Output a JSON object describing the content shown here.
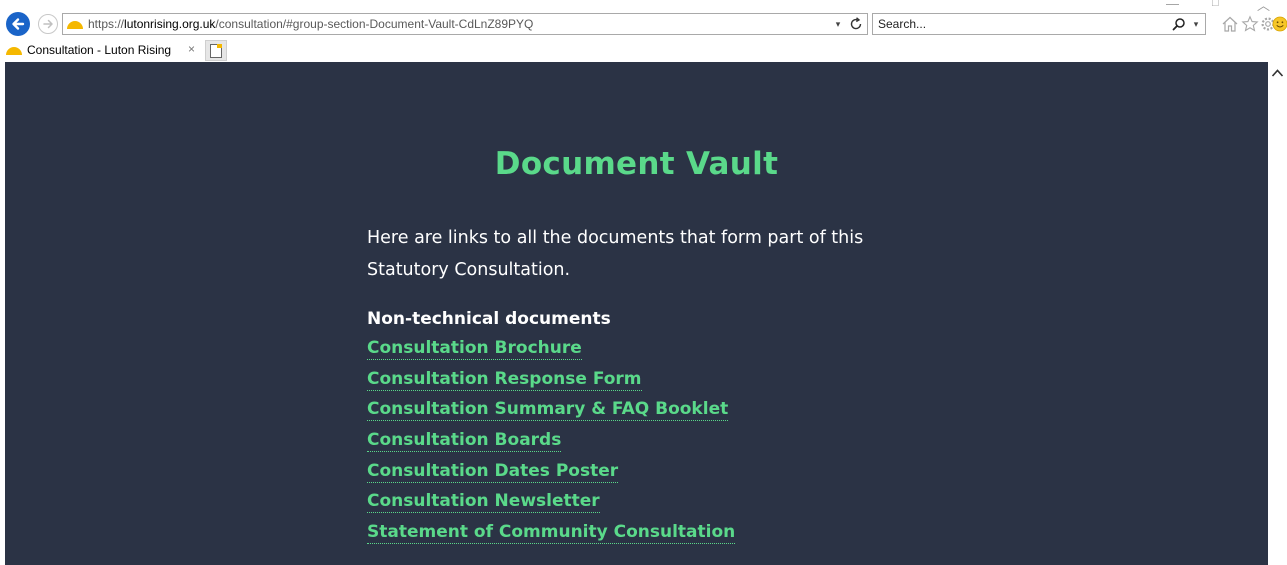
{
  "browser": {
    "url_prefix": "https://",
    "url_domain": "lutonrising.org.uk",
    "url_path": "/consultation/#group-section-Document-Vault-CdLnZ89PYQ",
    "search_placeholder": "Search...",
    "tab_title": "Consultation - Luton Rising",
    "tab_close": "×"
  },
  "page": {
    "title": "Document Vault",
    "intro": "Here are links to all the documents that form part of this Statutory Consultation.",
    "section_heading": "Non-technical documents",
    "documents": [
      "Consultation Brochure",
      "Consultation Response Form",
      "Consultation Summary & FAQ Booklet",
      "Consultation Boards",
      "Consultation Dates Poster",
      "Consultation Newsletter",
      "Statement of Community Consultation"
    ]
  },
  "colors": {
    "page_background": "#2b3345",
    "accent_green": "#5ad98a",
    "browser_back_blue": "#1a64c8"
  },
  "icons": [
    "back-arrow-icon",
    "forward-arrow-icon",
    "site-favicon",
    "refresh-icon",
    "search-icon",
    "home-icon",
    "favorites-star-icon",
    "settings-gear-icon",
    "smiley-feedback-icon",
    "new-tab-icon",
    "scroll-up-icon"
  ]
}
